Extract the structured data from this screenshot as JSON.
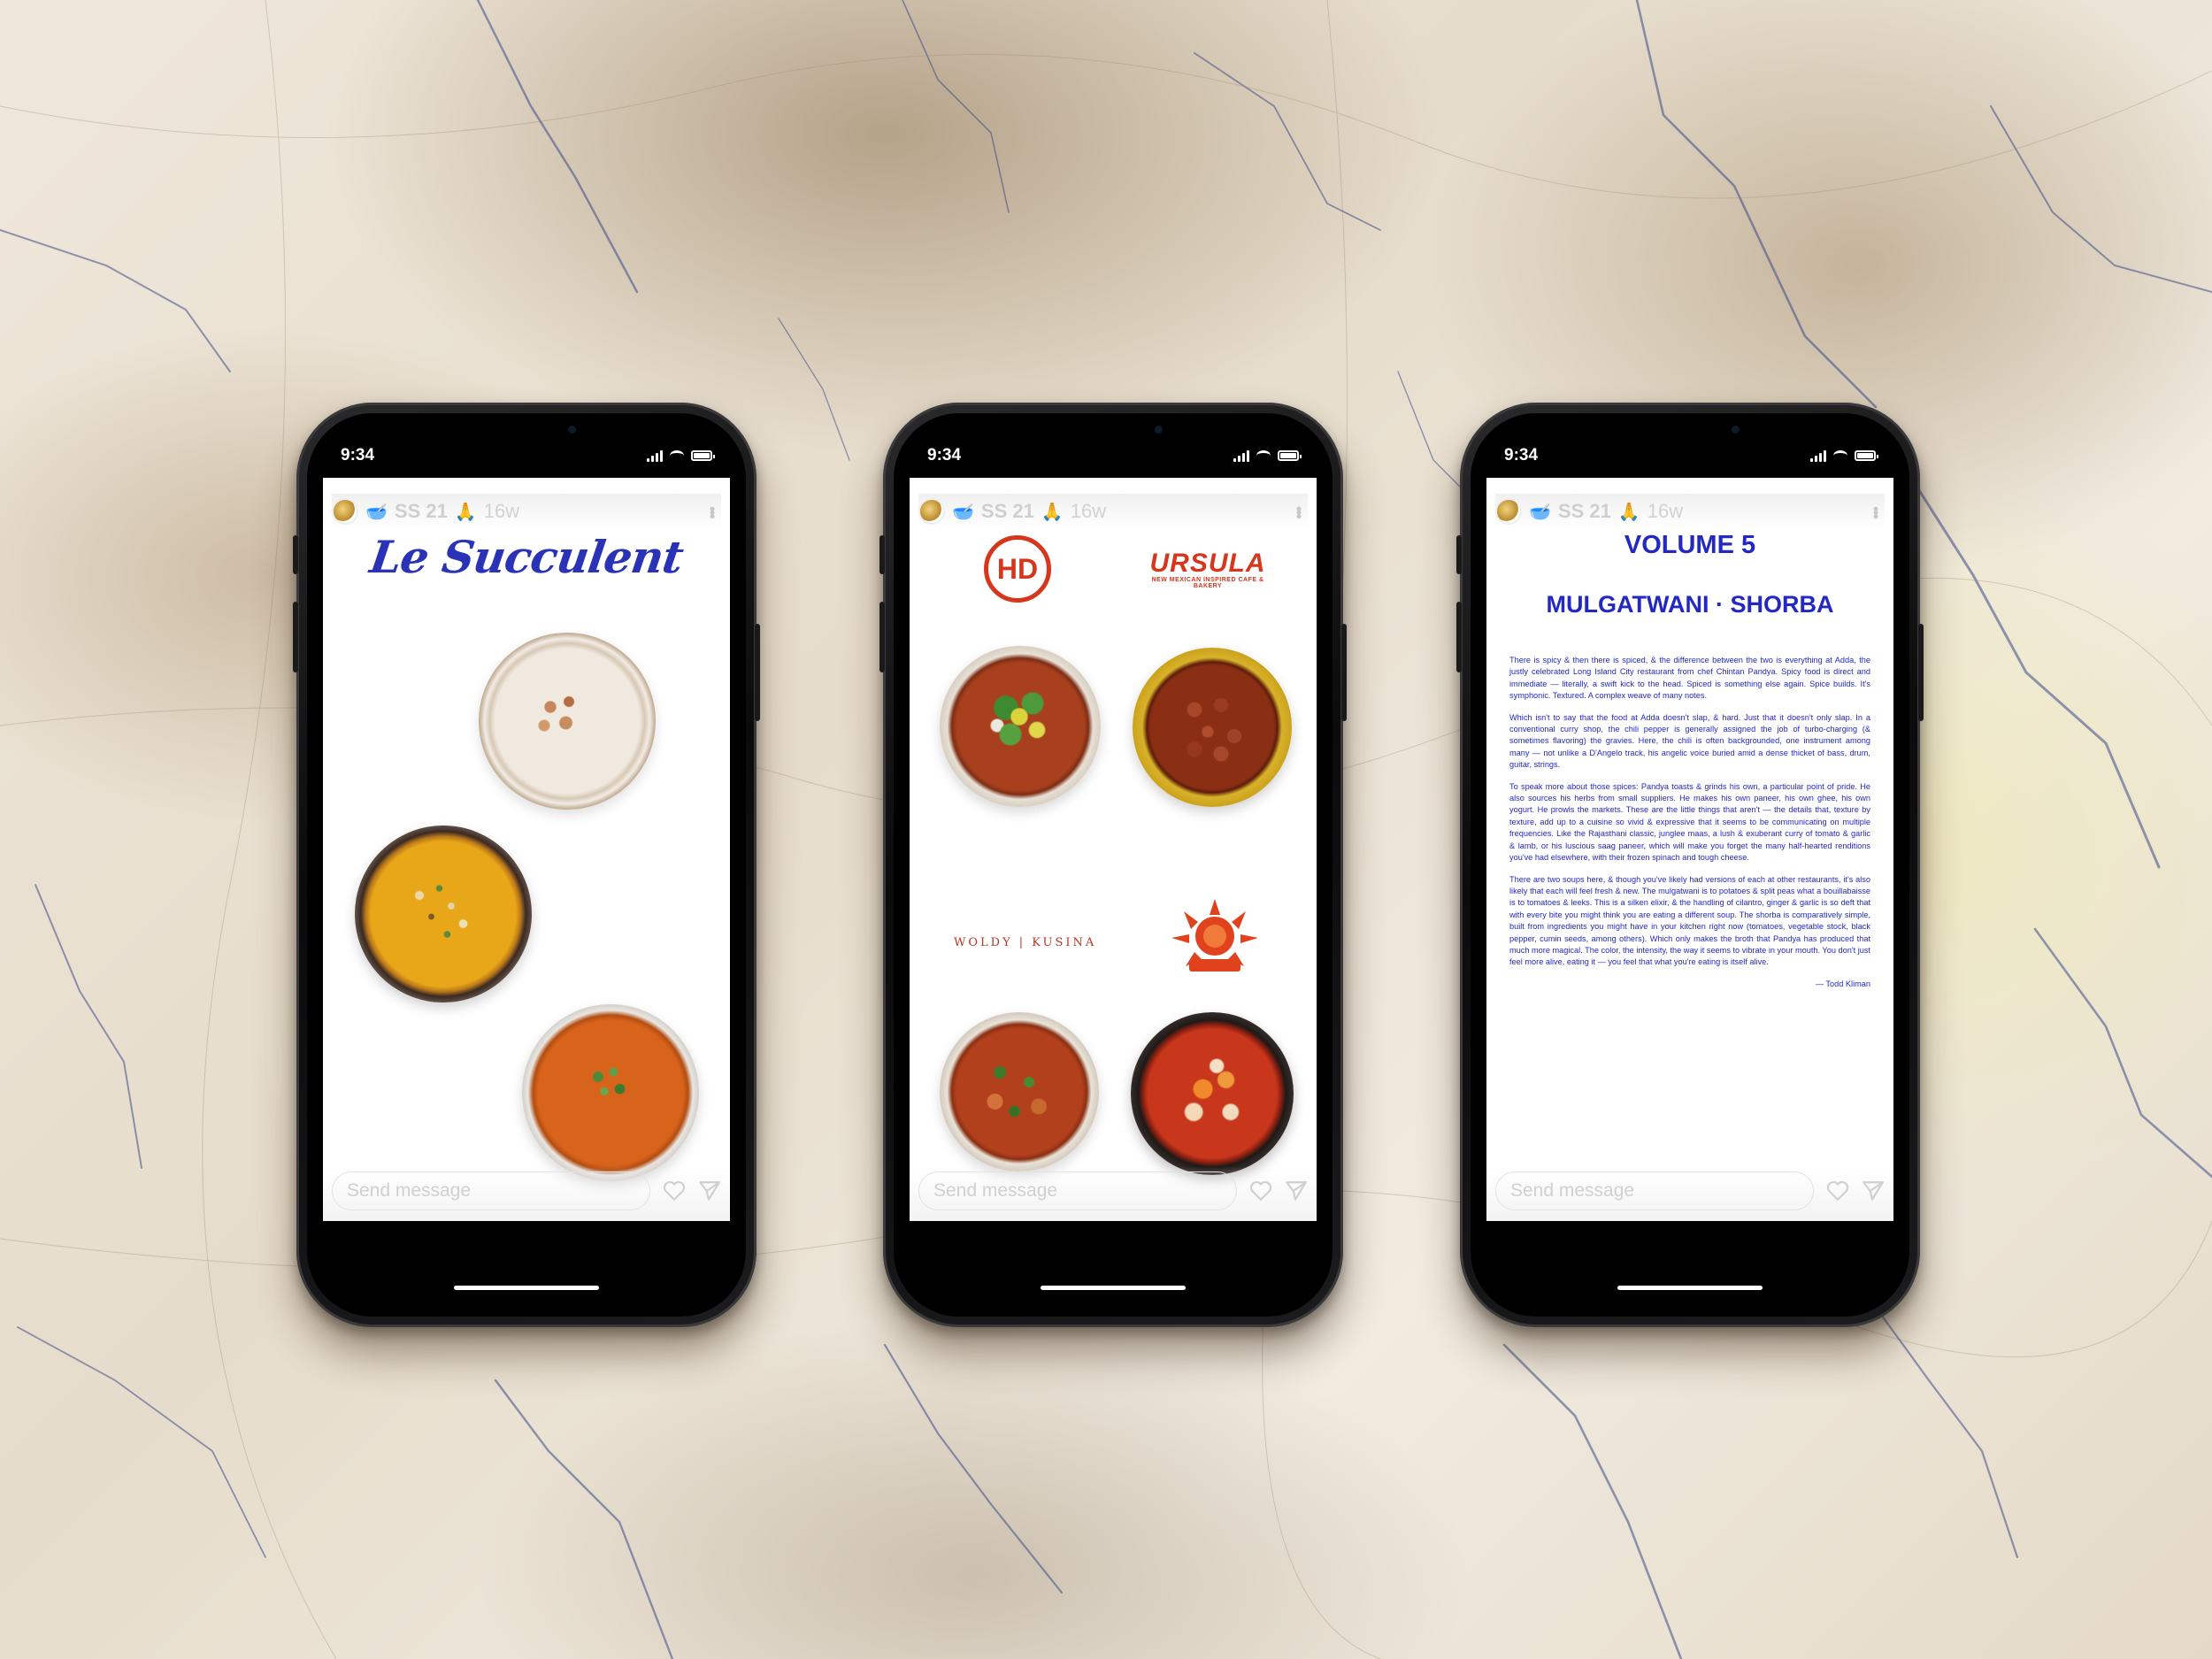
{
  "phones": [
    {
      "status_time": "9:34",
      "story": {
        "user": "SS 21",
        "age": "16w",
        "send_placeholder": "Send message"
      },
      "title": "Le Succulent"
    },
    {
      "status_time": "9:34",
      "story": {
        "user": "SS 21",
        "age": "16w",
        "send_placeholder": "Send message"
      },
      "logos": {
        "hd": "HD",
        "ursula": "URSULA",
        "ursula_tagline": "NEW MEXICAN INSPIRED CAFE & BAKERY",
        "woldy": "WOLDY | KUSINA"
      }
    },
    {
      "status_time": "9:34",
      "story": {
        "user": "SS 21",
        "age": "16w",
        "send_placeholder": "Send message"
      },
      "volume": "VOLUME 5",
      "soups": "MULGATWANI · SHORBA",
      "paragraphs": [
        "There is spicy & then there is spiced, & the difference between the two is everything at Adda, the justly celebrated Long Island City restaurant from chef Chintan Pandya. Spicy food is direct and immediate — literally, a swift kick to the head. Spiced is something else again. Spice builds. It's symphonic. Textured. A complex weave of many notes.",
        "Which isn't to say that the food at Adda doesn't slap, & hard. Just that it doesn't only slap. In a conventional curry shop, the chili pepper is generally assigned the job of turbo-charging (& sometimes flavoring) the gravies. Here, the chili is often backgrounded, one instrument among many — not unlike a D'Angelo track, his angelic voice buried amid a dense thicket of bass, drum, guitar, strings.",
        "To speak more about those spices: Pandya toasts & grinds his own, a particular point of pride. He also sources his herbs from small suppliers. He makes his own paneer, his own ghee, his own yogurt. He prowls the markets. These are the little things that aren't — the details that, texture by texture, add up to a cuisine so vivid & expressive that it seems to be communicating on multiple frequencies. Like the Rajasthani classic, junglee maas, a lush & exuberant curry of tomato & garlic & lamb, or his luscious saag paneer, which will make you forget the many half-hearted renditions you've had elsewhere, with their frozen spinach and tough cheese.",
        "There are two soups here, & though you've likely had versions of each at other restaurants, it's also likely that each will feel fresh & new. The mulgatwani is to potatoes & split peas what a bouillabaisse is to tomatoes & leeks. This is a silken elixir, & the handling of cilantro, ginger & garlic is so deft that with every bite you might think you are eating a different soup. The shorba is comparatively simple, built from ingredients you might have in your kitchen right now (tomatoes, vegetable stock, black pepper, cumin seeds, among others). Which only makes the broth that Pandya has produced that much more magical. The color, the intensity, the way it seems to vibrate in your mouth. You don't just feel more alive, eating it — you feel that what you're eating is itself alive."
      ],
      "byline": "— Todd Kliman"
    }
  ]
}
